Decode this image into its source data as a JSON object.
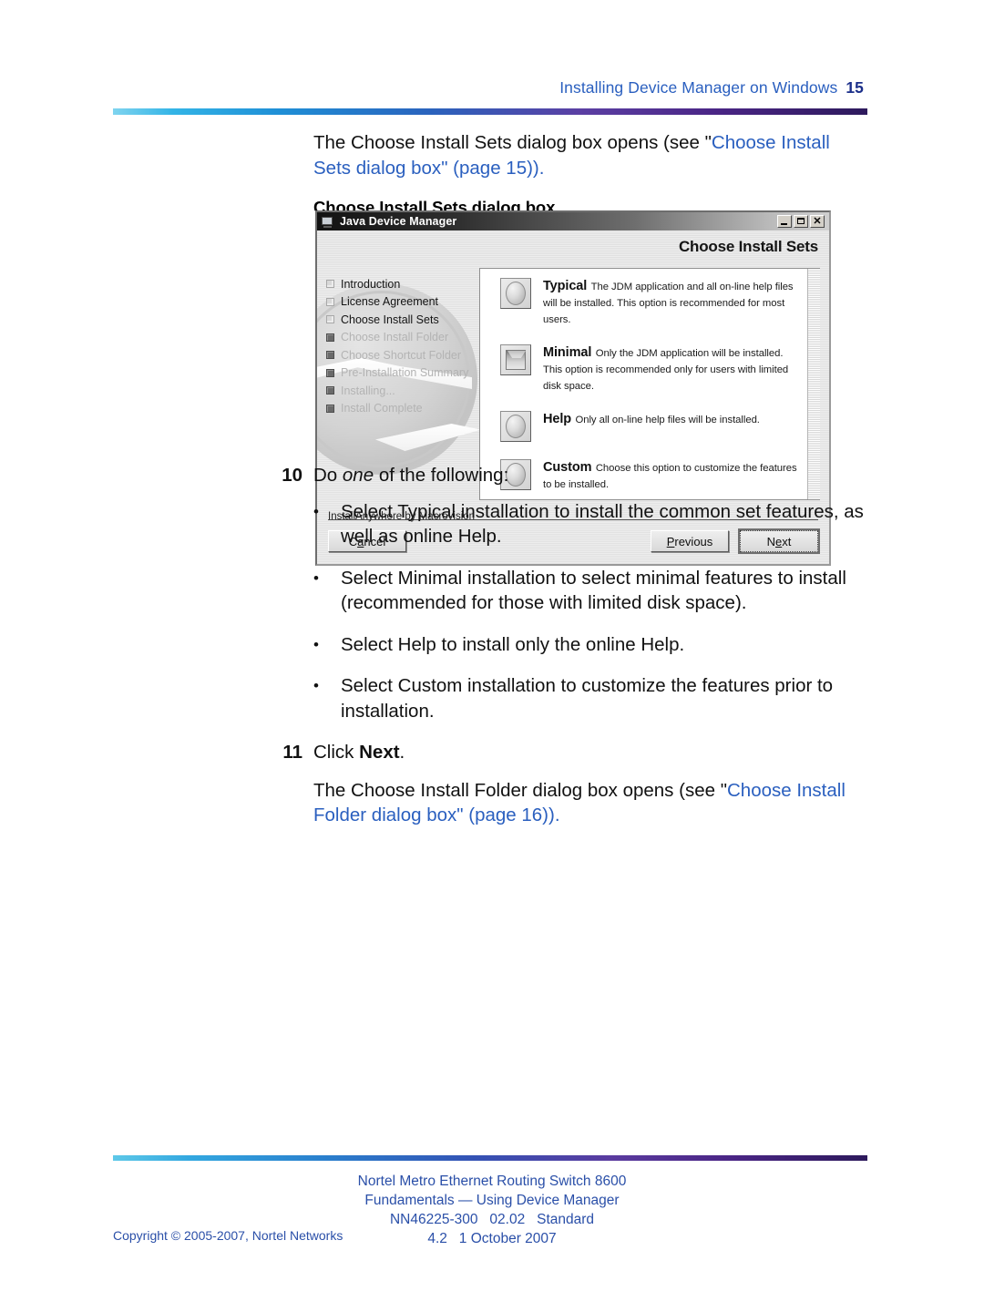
{
  "header": {
    "title": "Installing Device Manager on Windows",
    "page_number": "15",
    "rule_colors": [
      "#7fd4ef",
      "#1f8fd6",
      "#2a63bd",
      "#4a2585",
      "#2d1a5c"
    ]
  },
  "intro": {
    "text_before": "The Choose Install Sets dialog box opens (see \"",
    "link_text": "Choose Install Sets dialog box",
    "text_after": "\" (page 15)).",
    "link_color": "#2a5fbf"
  },
  "figure": {
    "caption": "Choose Install Sets dialog box"
  },
  "dialog": {
    "window_title": "Java Device Manager",
    "window_icon": "device-manager-icon",
    "controls": [
      {
        "name": "minimize",
        "glyph": "_"
      },
      {
        "name": "maximize",
        "glyph": "□"
      },
      {
        "name": "close",
        "glyph": "✕"
      }
    ],
    "heading": "Choose Install Sets",
    "steps": [
      {
        "label": "Introduction",
        "state": "done"
      },
      {
        "label": "License Agreement",
        "state": "done"
      },
      {
        "label": "Choose Install Sets",
        "state": "done"
      },
      {
        "label": "Choose Install Folder",
        "state": "todo"
      },
      {
        "label": "Choose Shortcut Folder",
        "state": "todo"
      },
      {
        "label": "Pre-Installation Summary",
        "state": "todo"
      },
      {
        "label": "Installing...",
        "state": "todo"
      },
      {
        "label": "Install Complete",
        "state": "todo"
      }
    ],
    "options": [
      {
        "title": "Typical",
        "icon": "sphere-icon",
        "desc": "The JDM application and all on-line help files will be installed. This option is recommended for most users."
      },
      {
        "title": "Minimal",
        "icon": "cube-icon",
        "desc": "Only the JDM application will be installed.  This option is recommended only for users with limited disk space."
      },
      {
        "title": "Help",
        "icon": "sphere-icon",
        "desc": "Only all on-line help files will be installed."
      },
      {
        "title": "Custom",
        "icon": "sphere-icon",
        "desc": "Choose this option to customize the features to be installed."
      }
    ],
    "brand": "InstallAnywhere by Macrovision",
    "buttons": {
      "cancel": {
        "pre": "C",
        "mnemonic": "a",
        "post": "ncel"
      },
      "previous": {
        "pre": "",
        "mnemonic": "P",
        "post": "revious"
      },
      "next": {
        "pre": "N",
        "mnemonic": "e",
        "post": "xt"
      }
    }
  },
  "procedure": [
    {
      "number": "10",
      "text_pre": "Do ",
      "text_em": "one",
      "text_post": " of the following:"
    }
  ],
  "bullets": [
    {
      "marker": "•",
      "text": "Select Typical installation to install the common set features, as well as online Help."
    },
    {
      "marker": "•",
      "text": "Select Minimal installation to select minimal features to install (recommended for those with limited disk space)."
    },
    {
      "marker": "•",
      "text": "Select Help to install only the online Help."
    },
    {
      "marker": "•",
      "text": "Select Custom installation to customize the features prior to installation."
    }
  ],
  "step11": {
    "number": "11",
    "text_pre": "Click ",
    "text_bold": "Next",
    "text_post": "."
  },
  "closing": {
    "text_before": "The Choose Install Folder dialog box opens (see \"",
    "link_text": "Choose Install Folder dialog box",
    "text_after": "\" (page 16))."
  },
  "footer": {
    "line1": "Nortel Metro Ethernet Routing Switch 8600",
    "line2": "Fundamentals — Using Device Manager",
    "line3": "NN46225-300   02.02   Standard",
    "line4": "4.2   1 October 2007",
    "copyright": "Copyright © 2005-2007, Nortel Networks",
    "text_color": "#2a4fa8"
  }
}
